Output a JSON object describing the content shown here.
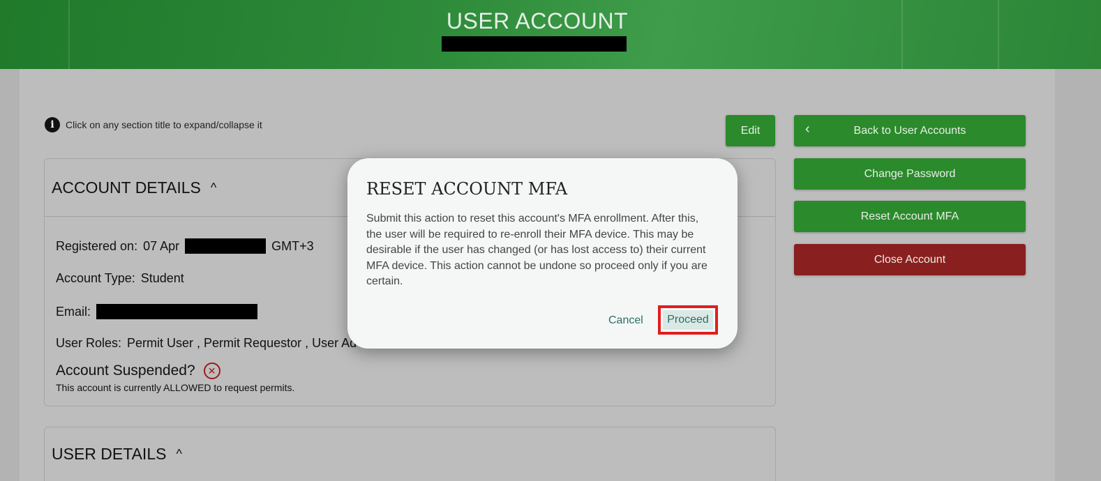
{
  "header": {
    "title": "USER ACCOUNT"
  },
  "info": {
    "icon": "info-icon",
    "text": "Click on any section title to expand/collapse it"
  },
  "actions": {
    "edit": "Edit",
    "back": "Back to User Accounts",
    "change_password": "Change Password",
    "reset_mfa": "Reset Account MFA",
    "close_account": "Close Account"
  },
  "account_details": {
    "title": "ACCOUNT DETAILS",
    "registered_label": "Registered on:",
    "registered_prefix": "07 Apr",
    "registered_suffix": "GMT+3",
    "account_type_label": "Account Type:",
    "account_type_value": "Student",
    "email_label": "Email:",
    "roles_label": "User Roles:",
    "roles_visible": "Permit User , Permit Requestor , User Ad",
    "suspended_label": "Account Suspended?",
    "suspended_note": "This account is currently ALLOWED to request permits."
  },
  "user_details": {
    "title": "USER DETAILS"
  },
  "modal": {
    "title": "RESET ACCOUNT MFA",
    "body": "Submit this action to reset this account's MFA enrollment. After this, the user will be required to re-enroll their MFA device. This may be desirable if the user has changed (or has lost access to) their current MFA device. This action cannot be undone so proceed only if you are certain.",
    "cancel": "Cancel",
    "proceed": "Proceed"
  },
  "colors": {
    "primary_green": "#2b8a2b",
    "danger_red": "#8a1f1f",
    "highlight_outline": "#e11d1d",
    "modal_link": "#2c6e66"
  }
}
